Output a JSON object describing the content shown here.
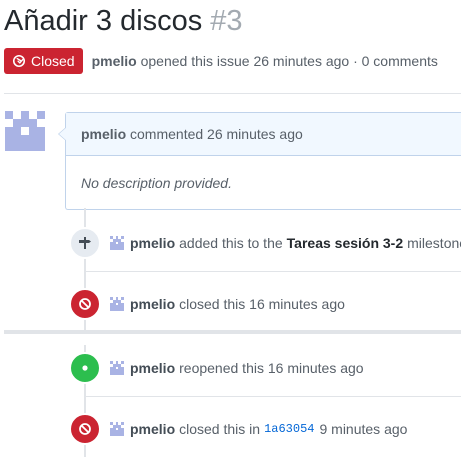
{
  "issue": {
    "title": "Añadir 3 discos",
    "number": "#3",
    "state_label": "Closed",
    "author": "pmelio",
    "opened_text": "opened this issue 26 minutes ago · 0 comments"
  },
  "comment": {
    "author": "pmelio",
    "time_text": "commented 26 minutes ago",
    "body": "No description provided."
  },
  "events": [
    {
      "actor": "pmelio",
      "icon": "milestone-icon",
      "text_before": "added this to the",
      "milestone": "Tareas sesión 3-2",
      "text_after": "milestone"
    },
    {
      "actor": "pmelio",
      "icon": "closed-icon",
      "text": "closed this 16 minutes ago"
    },
    {
      "actor": "pmelio",
      "icon": "reopened-icon",
      "text": "reopened this 16 minutes ago"
    },
    {
      "actor": "pmelio",
      "icon": "closed-icon",
      "text_before": "closed this in",
      "commit": "1a63054",
      "text_after": "9 minutes ago"
    }
  ],
  "colors": {
    "closed": "#cb2431",
    "reopened": "#2cbe4e",
    "link": "#0366d6",
    "avatar": "#a9b3e4"
  }
}
